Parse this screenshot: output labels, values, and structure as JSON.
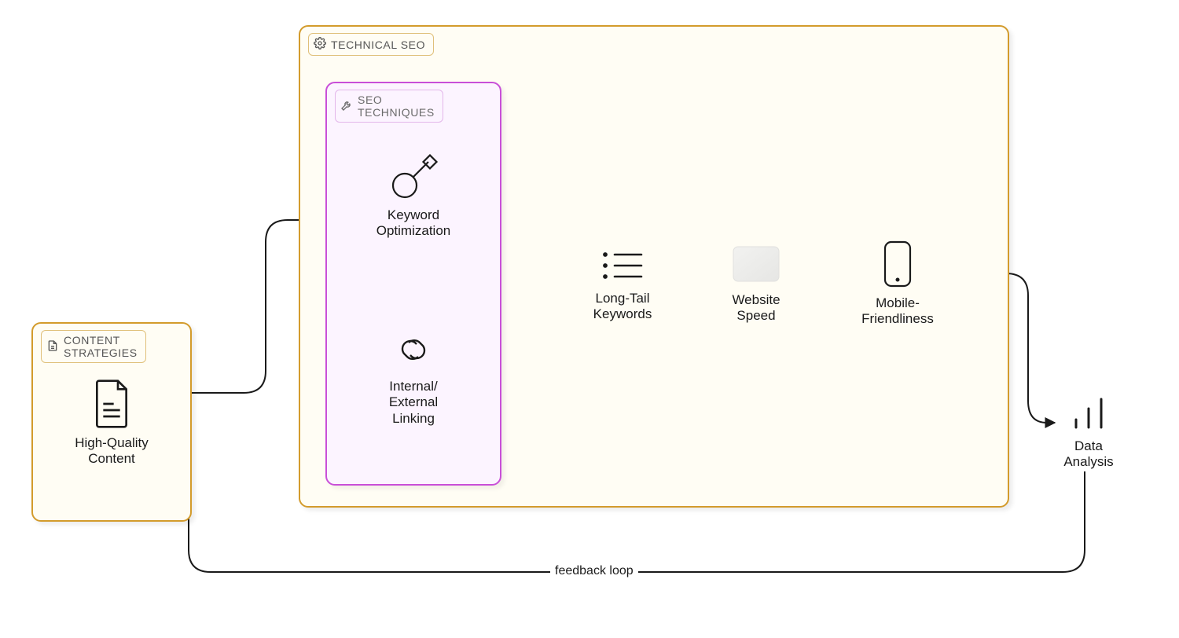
{
  "groups": {
    "content_strategies": {
      "label": "CONTENT\nSTRATEGIES"
    },
    "technical_seo": {
      "label": "TECHNICAL SEO"
    },
    "seo_techniques": {
      "label": "SEO\nTECHNIQUES"
    }
  },
  "nodes": {
    "high_quality_content": {
      "label": "High-Quality\nContent"
    },
    "keyword_optimization": {
      "label": "Keyword\nOptimization"
    },
    "linking": {
      "label": "Internal/\nExternal\nLinking"
    },
    "long_tail": {
      "label": "Long-Tail\nKeywords"
    },
    "website_speed": {
      "label": "Website\nSpeed"
    },
    "mobile_friendly": {
      "label": "Mobile-\nFriendliness"
    },
    "data_analysis": {
      "label": "Data\nAnalysis"
    }
  },
  "edges": {
    "feedback": {
      "label": "feedback loop"
    }
  },
  "colors": {
    "outer_border": "#d39b2c",
    "inner_border": "#c94fd8",
    "outer_bg": "#fffdf4",
    "inner_bg": "#fcf4ff",
    "stroke": "#1a1a1a"
  }
}
